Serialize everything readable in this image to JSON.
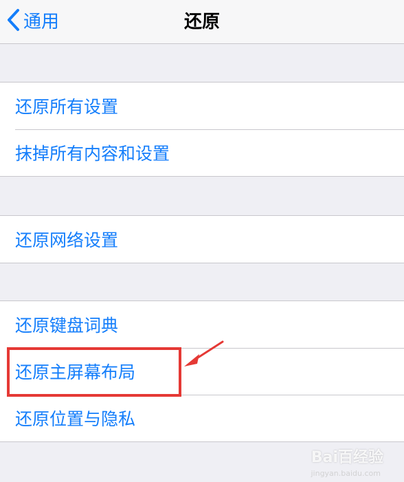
{
  "nav": {
    "back_label": "通用",
    "title": "还原"
  },
  "groups": [
    {
      "items": [
        {
          "label": "还原所有设置"
        },
        {
          "label": "抹掉所有内容和设置"
        }
      ]
    },
    {
      "items": [
        {
          "label": "还原网络设置"
        }
      ]
    },
    {
      "items": [
        {
          "label": "还原键盘词典"
        },
        {
          "label": "还原主屏幕布局"
        },
        {
          "label": "还原位置与隐私"
        }
      ]
    }
  ],
  "annotation": {
    "highlight_color": "#e53935",
    "icon": "pointer-arrow-icon"
  },
  "watermark": {
    "logo": "Bai百经验",
    "sub": "jingyan.baidu.com"
  },
  "colors": {
    "accent": "#147efb",
    "background": "#efeff4",
    "separator": "#c8c7cc"
  }
}
